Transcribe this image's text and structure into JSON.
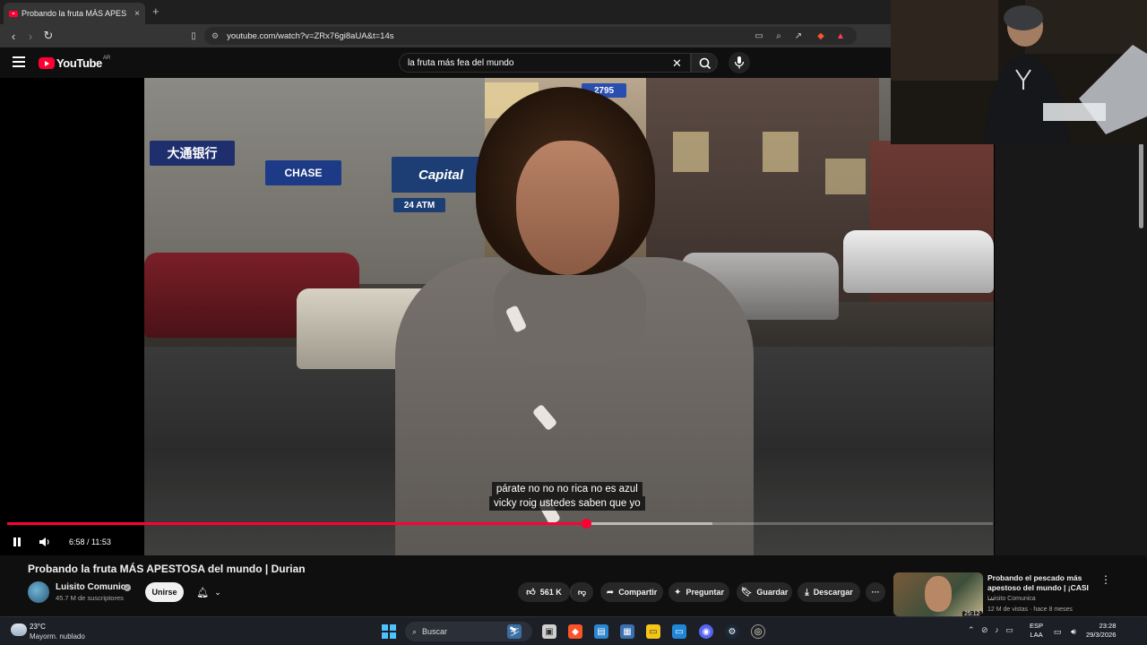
{
  "browser": {
    "tab_title": "Probando la fruta MÁS APES",
    "new_tab": "+",
    "tab_close": "×",
    "url": "youtube.com/watch?v=ZRx76gi8aUA&t=14s"
  },
  "youtube": {
    "logo_text": "YouTube",
    "country": "AR",
    "search_query": "la fruta más fea del mundo"
  },
  "video": {
    "caption_line1": "párate no no no rica no es azul",
    "caption_line2": "vicky roig ustedes saben que yo",
    "timecode": "6:58 / 11:53",
    "progress_fraction": 0.587,
    "buffer_fraction": 0.715,
    "scene_signs": {
      "bank": "CHASE",
      "capital": "Capital",
      "atm": "24 ATM",
      "chinese": "大通银行",
      "address": "2795"
    }
  },
  "info": {
    "title": "Probando la fruta MÁS APESTOSA del mundo | Durian",
    "channel": "Luisito Comunica",
    "subscribers": "45.7 M de suscriptores",
    "join": "Unirse",
    "likes": "561 K",
    "share": "Compartir",
    "ask": "Preguntar",
    "save": "Guardar",
    "download": "Descargar",
    "more": "···"
  },
  "recommended": {
    "title": "Probando el pescado más apestoso del mundo | ¡CASI ...",
    "channel": "Luisito Comunica",
    "meta": "12 M de vistas · hace 8 meses",
    "duration": "25:12",
    "more": "⋮"
  },
  "taskbar": {
    "temperature": "23°C",
    "condition": "Mayorm. nublado",
    "search": "Buscar",
    "lang1": "ESP",
    "lang2": "LAA",
    "time": "23:28",
    "date": "29/3/2026"
  },
  "colors": {
    "youtube_red": "#ff0033",
    "page_bg": "#0f0f0f",
    "pill_bg": "#272727",
    "taskbar_bg": "#1c1f26"
  }
}
